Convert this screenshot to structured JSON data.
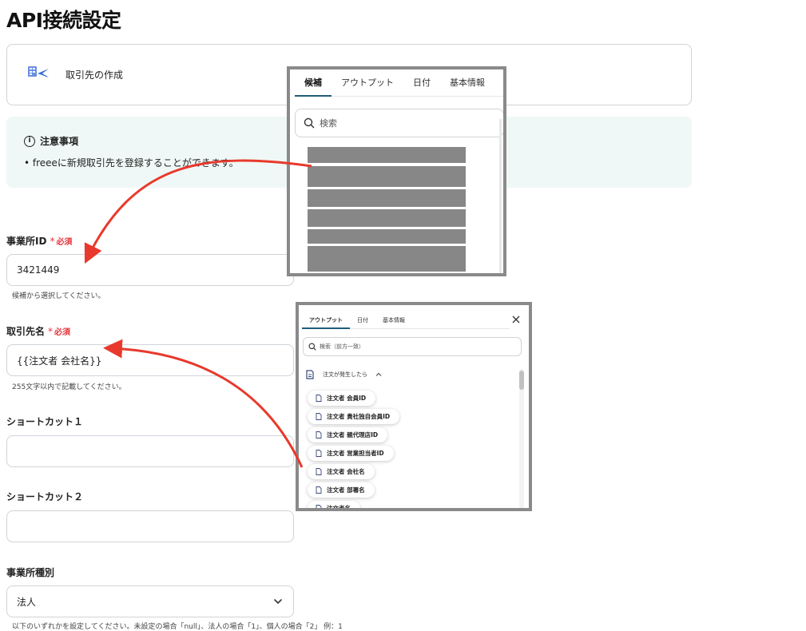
{
  "page": {
    "title": "API接続設定"
  },
  "app_card": {
    "label": "取引先の作成",
    "icon": "freee-app-icon"
  },
  "notice": {
    "title": "注意事項",
    "bullet": "• freeeに新規取引先を登録することができます。"
  },
  "fields": {
    "office_id": {
      "label": "事業所ID",
      "required_mark": "*",
      "required_text": "必須",
      "value": "3421449",
      "help": "候補から選択してください。"
    },
    "partner_name": {
      "label": "取引先名",
      "required_mark": "*",
      "required_text": "必須",
      "value": "{{注文者 会社名}}",
      "help": "255文字以内で記載してください。"
    },
    "shortcut1": {
      "label": "ショートカット１",
      "value": ""
    },
    "shortcut2": {
      "label": "ショートカット２",
      "value": ""
    },
    "office_type": {
      "label": "事業所種別",
      "value": "法人",
      "help": "以下のいずれかを設定してください。未設定の場合「null」、法人の場合「1」、個人の場合「2」 例：1"
    }
  },
  "popup_candidates": {
    "tabs": [
      "候補",
      "アウトプット",
      "日付",
      "基本情報"
    ],
    "active_tab": 0,
    "search_placeholder": "検索",
    "redacted_items": 6
  },
  "popup_outputs": {
    "tabs": [
      "アウトプット",
      "日付",
      "基本情報"
    ],
    "active_tab": 0,
    "search_placeholder": "検索（前方一致）",
    "group_label": "注文が発生したら",
    "items": [
      "注文者 会員ID",
      "注文者 貴社独自会員ID",
      "注文者 親代理店ID",
      "注文者 営業担当者ID",
      "注文者 会社名",
      "注文者 部署名",
      "注文者名"
    ]
  },
  "colors": {
    "accent": "#1f5c78",
    "required": "#e5343b",
    "arrow": "#e8392c",
    "notice_bg": "#eff8f6"
  }
}
